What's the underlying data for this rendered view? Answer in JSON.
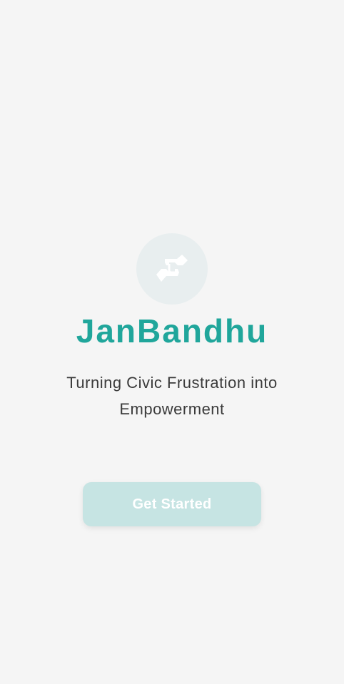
{
  "app": {
    "title": "JanBandhu",
    "tagline": "Turning Civic Frustration into Empowerment",
    "logo_icon": "handshake-icon"
  },
  "cta": {
    "label": "Get Started"
  },
  "colors": {
    "background": "#f5f5f5",
    "accent": "#20a69b",
    "logo_circle": "#e8eeef",
    "button_bg": "#c6e4e3",
    "button_text": "#ffffff"
  }
}
